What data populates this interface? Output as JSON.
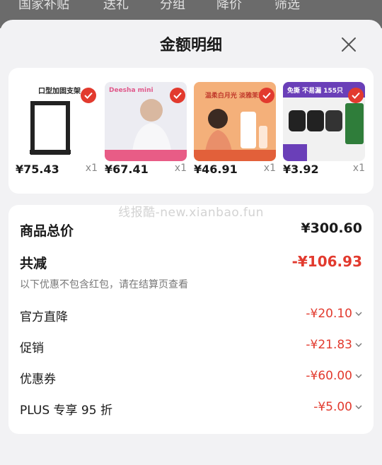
{
  "background_tabs": [
    "国家补贴",
    "送礼",
    "分组",
    "降价",
    "筛选"
  ],
  "sheet": {
    "title": "金额明细"
  },
  "products": [
    {
      "thumb_caption": "口型加固支架",
      "price": "¥75.43",
      "qty": "x1"
    },
    {
      "thumb_caption": "Deesha mini",
      "price": "¥67.41",
      "qty": "x1"
    },
    {
      "thumb_caption": "温柔白月光 淡雅茉莉",
      "price": "¥46.91",
      "qty": "x1"
    },
    {
      "thumb_caption": "免撕 不易漏 155只",
      "price": "¥3.92",
      "qty": "x1"
    }
  ],
  "watermark": "线报酷-new.xianbao.fun",
  "summary": {
    "total_label": "商品总价",
    "total_value": "¥300.60",
    "reduce_label": "共减",
    "reduce_value": "-¥106.93",
    "note": "以下优惠不包含红包，请在结算页查看"
  },
  "discounts": [
    {
      "label": "官方直降",
      "value": "-¥20.10"
    },
    {
      "label": "促销",
      "value": "-¥21.83"
    },
    {
      "label": "优惠券",
      "value": "-¥60.00"
    },
    {
      "label": "PLUS 专享 95 折",
      "value": "-¥5.00"
    }
  ],
  "colors": {
    "accent_red": "#e23a2e",
    "card_bg": "#ffffff",
    "sheet_bg": "#f2f2f4"
  }
}
